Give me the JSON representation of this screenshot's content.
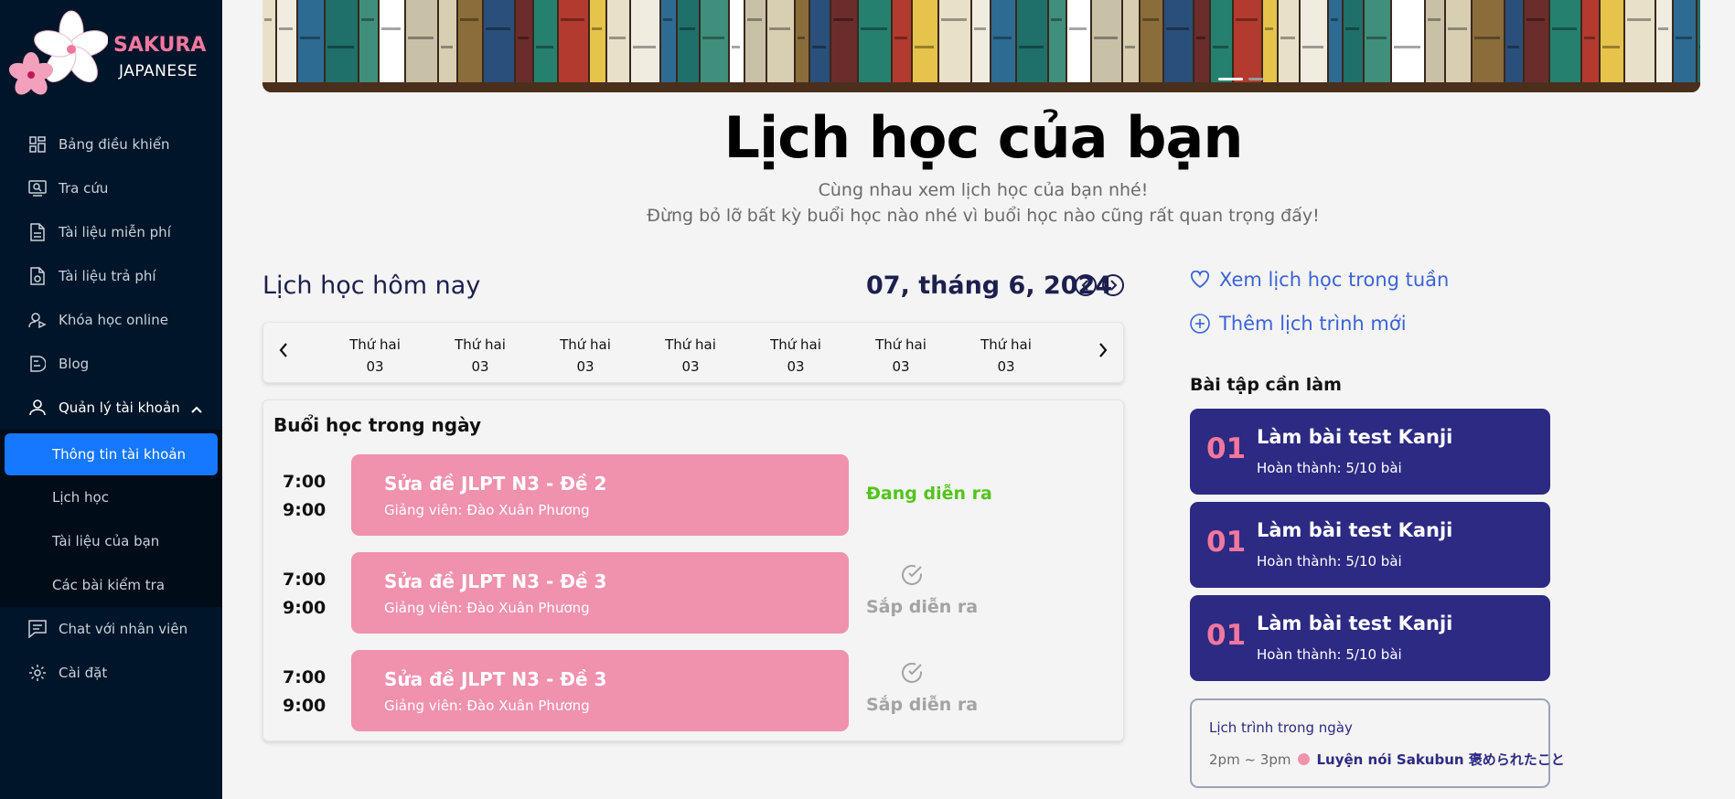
{
  "brand": {
    "name": "SAKURA",
    "sub": "JAPANESE"
  },
  "sidebar": {
    "items": [
      {
        "label": "Bảng điều khiển",
        "icon": "dashboard-icon"
      },
      {
        "label": "Tra cứu",
        "icon": "search-screen-icon"
      },
      {
        "label": "Tài liệu miễn phí",
        "icon": "document-icon"
      },
      {
        "label": "Tài liệu trả phí",
        "icon": "paid-document-icon"
      },
      {
        "label": "Khóa học online",
        "icon": "online-course-icon"
      },
      {
        "label": "Blog",
        "icon": "blog-icon"
      },
      {
        "label": "Quản lý tài khoản",
        "icon": "user-icon"
      }
    ],
    "submenu": [
      {
        "label": "Thông tin tài khoản"
      },
      {
        "label": "Lịch học"
      },
      {
        "label": "Tài liệu của bạn"
      },
      {
        "label": "Các bài kiểm tra"
      }
    ],
    "bottom": [
      {
        "label": "Chat với nhân viên",
        "icon": "chat-icon"
      },
      {
        "label": "Cài đặt",
        "icon": "gear-icon"
      }
    ]
  },
  "header": {
    "title": "Lịch học của bạn",
    "subtitle1": "Cùng nhau xem lịch học của bạn nhé!",
    "subtitle2": "Đừng bỏ lỡ bất kỳ buổi học nào nhé vì buổi học nào cũng rất quan trọng đấy!"
  },
  "schedule": {
    "today_label": "Lịch học hôm nay",
    "date": "07, tháng 6, 2024",
    "days": [
      {
        "name": "Thứ hai",
        "num": "03"
      },
      {
        "name": "Thứ hai",
        "num": "03"
      },
      {
        "name": "Thứ hai",
        "num": "03"
      },
      {
        "name": "Thứ hai",
        "num": "03"
      },
      {
        "name": "Thứ hai",
        "num": "03"
      },
      {
        "name": "Thứ hai",
        "num": "03"
      },
      {
        "name": "Thứ hai",
        "num": "03"
      }
    ],
    "sessions_title": "Buổi học trong ngày",
    "sessions": [
      {
        "start": "7:00",
        "end": "9:00",
        "title": "Sửa đề JLPT N3 - Đề 2",
        "teacher": "Giảng viên: Đào Xuân Phương",
        "status": "Đang diễn ra"
      },
      {
        "start": "7:00",
        "end": "9:00",
        "title": "Sửa đề JLPT N3 - Đề 3",
        "teacher": "Giảng viên: Đào Xuân Phương",
        "status": "Sắp diễn ra"
      },
      {
        "start": "7:00",
        "end": "9:00",
        "title": "Sửa đề JLPT N3 - Đề 3",
        "teacher": "Giảng viên: Đào Xuân Phương",
        "status": "Sắp diễn ra"
      }
    ]
  },
  "right": {
    "week_link": "Xem lịch học trong tuần",
    "add_link": "Thêm lịch trình mới",
    "homework_title": "Bài tập cần làm",
    "homework": [
      {
        "num": "01",
        "title": "Làm bài test Kanji",
        "progress": "Hoàn thành: 5/10 bài"
      },
      {
        "num": "01",
        "title": "Làm bài test Kanji",
        "progress": "Hoàn thành: 5/10 bài"
      },
      {
        "num": "01",
        "title": "Làm bài test Kanji",
        "progress": "Hoàn thành: 5/10 bài"
      }
    ],
    "daily": {
      "title": "Lịch trình trong ngày",
      "time": "2pm ~ 3pm",
      "event": "Luyện nói Sakubun 褒められたこと"
    }
  },
  "colors": {
    "sidebar": "#001529",
    "active": "#1677ff",
    "pink": "#f091ae",
    "navy": "#2d2a83",
    "live": "#52c41a",
    "link": "#3b63d6"
  }
}
